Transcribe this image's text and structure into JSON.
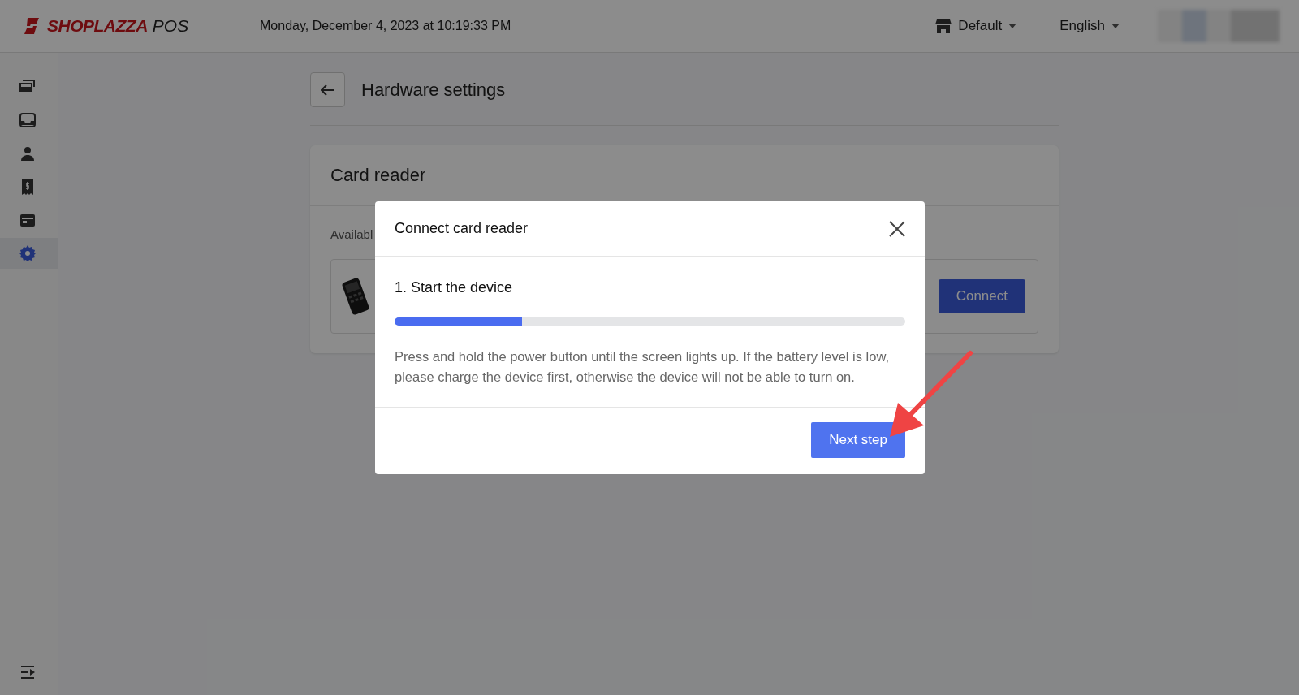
{
  "header": {
    "logo_brand": "SHOPLAZZA",
    "logo_product": "POS",
    "datetime": "Monday, December 4, 2023 at 10:19:33 PM",
    "store": "Default",
    "language": "English"
  },
  "sidebar": {
    "items": [
      {
        "kind": "orders",
        "selected": false
      },
      {
        "kind": "inbox",
        "selected": false
      },
      {
        "kind": "customer",
        "selected": false
      },
      {
        "kind": "receipt",
        "selected": false
      },
      {
        "kind": "register",
        "selected": false
      },
      {
        "kind": "settings",
        "selected": true
      }
    ]
  },
  "page": {
    "title": "Hardware settings",
    "card_title": "Card reader",
    "available_label": "Availabl",
    "connect_button": "Connect"
  },
  "modal": {
    "title": "Connect card reader",
    "step_title": "1. Start the device",
    "level": 0.25,
    "description": "Press and hold the power button until the screen lights up. If the battery level is low, please charge the device first, otherwise the device will not be able to turn on.",
    "button": "Next step"
  }
}
